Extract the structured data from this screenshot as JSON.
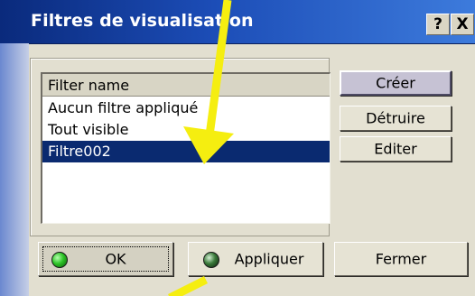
{
  "window": {
    "title": "Filtres de visualisation",
    "help_label": "?",
    "close_label": "X"
  },
  "list": {
    "header": "Filter name",
    "items": [
      {
        "label": "Aucun filtre appliqué",
        "selected": false
      },
      {
        "label": "Tout visible",
        "selected": false
      },
      {
        "label": "Filtre002",
        "selected": true
      }
    ]
  },
  "side_buttons": {
    "create": "Créer",
    "destroy": "Détruire",
    "edit": "Editer"
  },
  "bottom_buttons": {
    "ok": "OK",
    "apply": "Appliquer",
    "close": "Fermer"
  },
  "colors": {
    "title_bar": "#1c4db7",
    "selection": "#0a2a70",
    "annotation_arrow": "#f5ee10"
  },
  "icons": {
    "ok_led": "green-led-icon",
    "apply_led": "dark-green-led-icon"
  }
}
